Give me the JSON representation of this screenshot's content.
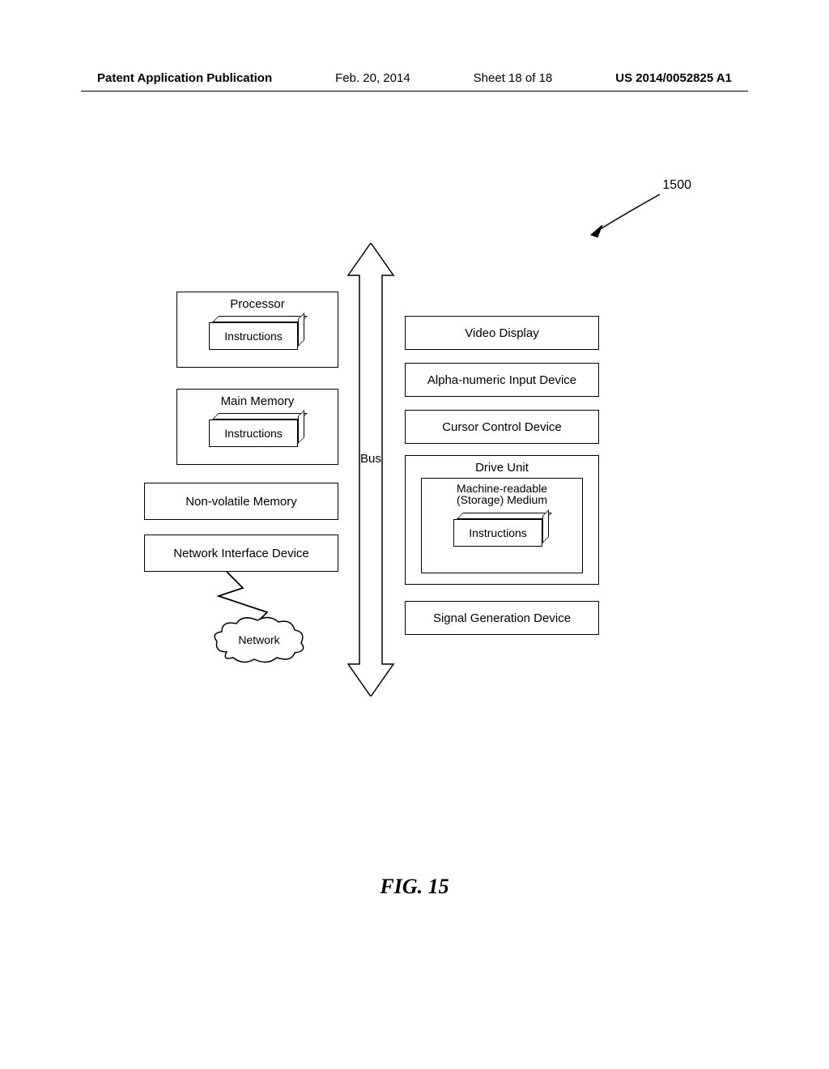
{
  "header": {
    "publication": "Patent Application Publication",
    "date": "Feb. 20, 2014",
    "sheet": "Sheet 18 of 18",
    "pubno": "US 2014/0052825 A1"
  },
  "figure": {
    "caption": "FIG. 15",
    "ref": "1500",
    "bus_label": "Bus",
    "left": {
      "processor": {
        "title": "Processor",
        "instructions": "Instructions"
      },
      "main_memory": {
        "title": "Main Memory",
        "instructions": "Instructions"
      },
      "nonvolatile": "Non-volatile Memory",
      "nid": "Network Interface Device",
      "network": "Network"
    },
    "right": {
      "video": "Video Display",
      "alpha": "Alpha-numeric Input Device",
      "cursor": "Cursor Control Device",
      "drive": {
        "title": "Drive Unit",
        "medium_line1": "Machine-readable",
        "medium_line2": "(Storage) Medium",
        "instructions": "Instructions"
      },
      "signal": "Signal Generation Device"
    }
  }
}
